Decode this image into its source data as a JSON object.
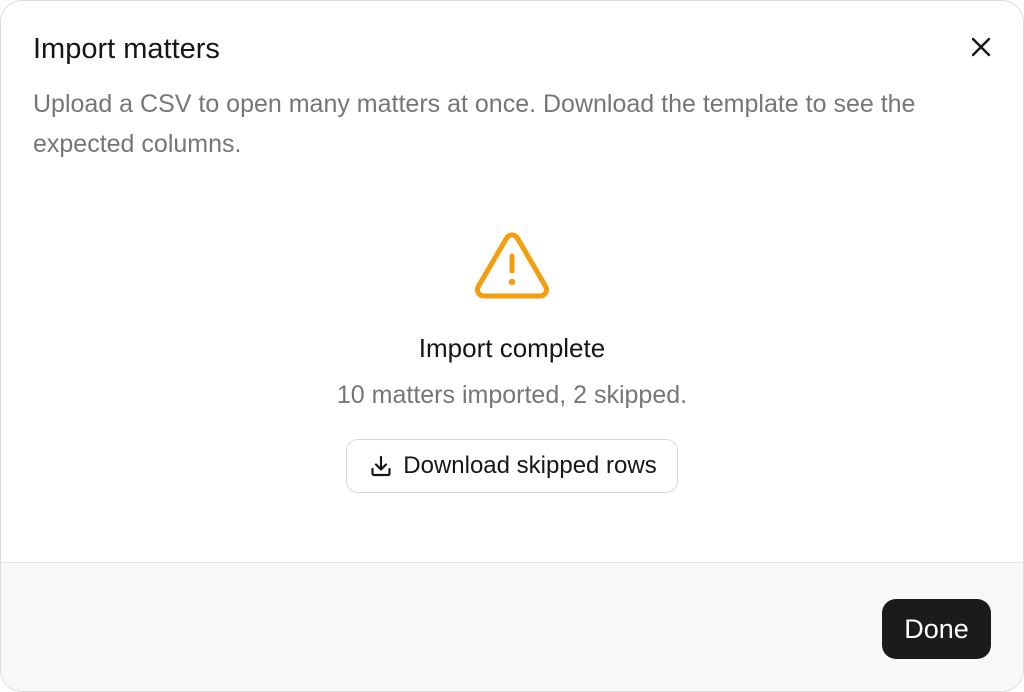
{
  "dialog": {
    "title": "Import matters",
    "description": "Upload a CSV to open many matters at once. Download the template to see the expected columns.",
    "close_icon": "close-icon"
  },
  "status": {
    "icon": "warning-triangle-icon",
    "icon_color": "#F59E0B",
    "title": "Import complete",
    "detail": "10 matters imported, 2 skipped.",
    "download_label": "Download skipped rows",
    "download_icon": "download-icon"
  },
  "footer": {
    "done_label": "Done",
    "done_color": "#1B1B1B"
  }
}
